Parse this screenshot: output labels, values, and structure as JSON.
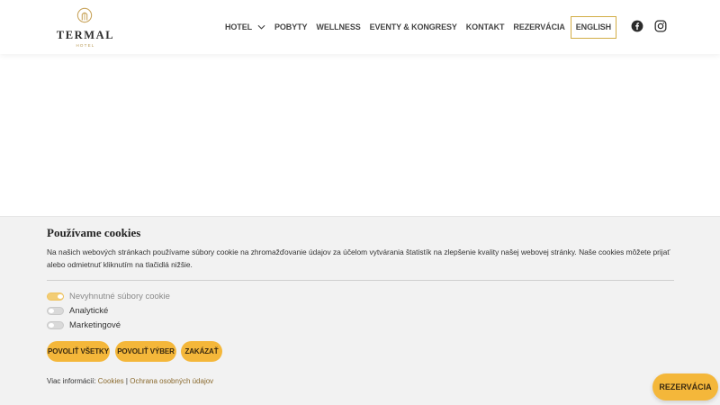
{
  "header": {
    "logo": {
      "name": "TERMAL",
      "sub": "HOTEL"
    },
    "nav": [
      {
        "label": "HOTEL",
        "has_dropdown": true
      },
      {
        "label": "POBYTY"
      },
      {
        "label": "WELLNESS"
      },
      {
        "label": "EVENTY & KONGRESY"
      },
      {
        "label": "KONTAKT"
      },
      {
        "label": "REZERVÁCIA"
      }
    ],
    "language": "ENGLISH",
    "social_icons": [
      "facebook-icon",
      "instagram-icon"
    ]
  },
  "cookie": {
    "title": "Používame cookies",
    "text": "Na našich webových stránkach používame súbory cookie na zhromažďovanie údajov za účelom vytvárania štatistík na zlepšenie kvality našej webovej stránky. Naše cookies môžete prijať alebo odmietnuť kliknutím na tlačidlá nižšie.",
    "toggles": [
      {
        "label": "Nevyhnutné súbory cookie",
        "checked": true,
        "disabled": true
      },
      {
        "label": "Analytické",
        "checked": false
      },
      {
        "label": "Marketingové",
        "checked": false
      }
    ],
    "buttons": {
      "allow_all": "POVOLIŤ VŠETKY",
      "allow_selection": "POVOLIŤ VÝBER",
      "deny": "ZAKÁZAŤ"
    },
    "more_info": {
      "prefix": "Viac informácií:",
      "cookies_link": "Cookies",
      "separator": "|",
      "privacy_link": "Ochrana osobných údajov"
    }
  },
  "floating_button": "REZERVÁCIA",
  "colors": {
    "accent": "#f4b73a",
    "accent_light": "#f3cd74",
    "gold_border": "#d2ad45",
    "panel_bg": "#f2f2f2"
  }
}
